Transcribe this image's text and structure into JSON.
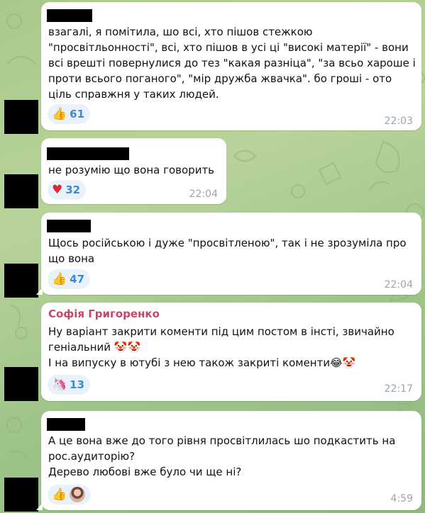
{
  "messages": [
    {
      "text": "взагалі, я помітила, шо всі, хто пішов стежкою \"просвітльонності\", всі, хто пішов в усі ці \"високі матерії\" - вони всі врешті повернулися до тез \"какая разніца\", \"за всьо харошe і проти всього поганого\", \"мір дружба жвачка\". бо гроші - ото ціль справжня у таких людей.",
      "reaction": {
        "emoji": "👍",
        "icon": "thumbs-up-icon",
        "count": "61"
      },
      "time": "22:03"
    },
    {
      "text": "не розумію що вона говорить",
      "reaction": {
        "emoji": "❤️",
        "icon": "heart-icon",
        "count": "32"
      },
      "time": "22:04"
    },
    {
      "text": "Щось російською і дуже \"просвітленою\", так і не зрозуміла про що вона",
      "reaction": {
        "emoji": "👍",
        "icon": "thumbs-up-icon",
        "count": "47"
      },
      "time": "22:04"
    },
    {
      "author": "Софія Григоренко",
      "text": "Ну варіант закрити коменти під цим постом в інсті, звичайно геніальний 🤡🤡\nІ на випуску в ютубі з нею також закриті коменти😂🤡",
      "reaction": {
        "emoji": "🦄",
        "icon": "unicorn-icon",
        "count": "13"
      },
      "time": "22:17"
    },
    {
      "text": "А це вона вже до того рівня просвітлилась шо подкастить на рос.аудиторію?\nДерево любові вже було чи ще ні?",
      "reaction": {
        "emoji": "👍",
        "icon": "thumbs-up-icon"
      },
      "time": "4:59"
    }
  ],
  "colors": {
    "author_name": "#c7466a",
    "reaction_count": "#3a8bd0",
    "time": "#9aa5ad"
  }
}
